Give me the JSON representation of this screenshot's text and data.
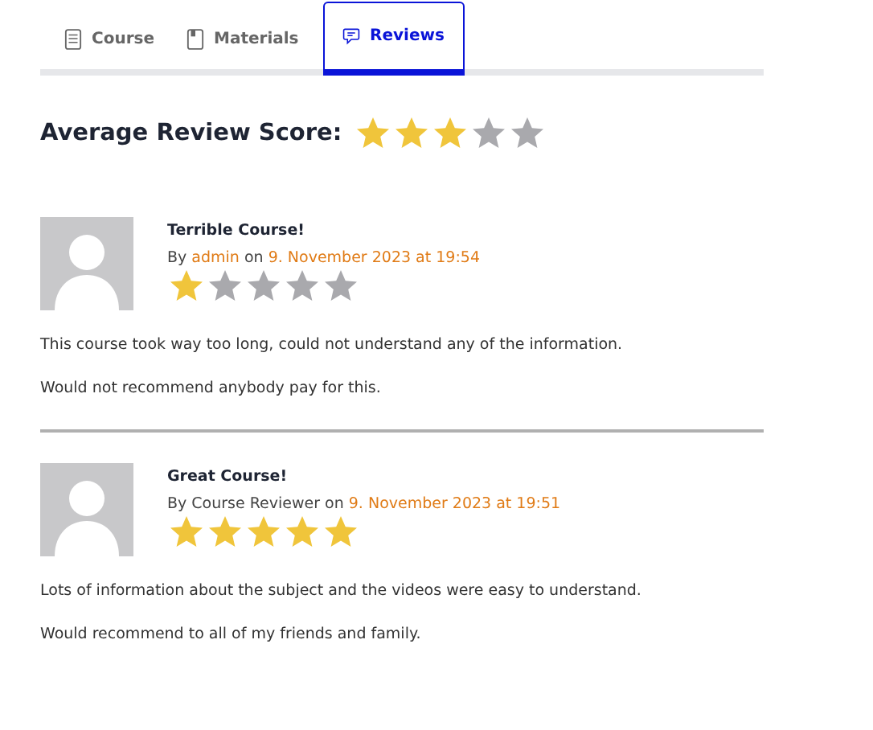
{
  "tabs": [
    {
      "label": "Course",
      "kind": "document",
      "selected": false
    },
    {
      "label": "Materials",
      "kind": "book",
      "selected": false
    },
    {
      "label": "Reviews",
      "kind": "chat",
      "selected": true
    }
  ],
  "average": {
    "label": "Average Review Score:",
    "stars": 3
  },
  "reviews": [
    {
      "title": "Terrible Course!",
      "by": "By",
      "author": "admin",
      "author_link": true,
      "on": "on",
      "date": "9. November 2023 at 19:54",
      "stars": 1,
      "paragraphs": [
        "This course took way too long, could not understand any of the information.",
        "Would not recommend anybody pay for this."
      ]
    },
    {
      "title": "Great Course!",
      "by": "By",
      "author": "Course Reviewer",
      "author_link": false,
      "on": "on",
      "date": "9. November 2023 at 19:51",
      "stars": 5,
      "paragraphs": [
        "Lots of information about the subject and the videos were easy to understand.",
        "Would recommend to all of my friends and family."
      ]
    }
  ]
}
